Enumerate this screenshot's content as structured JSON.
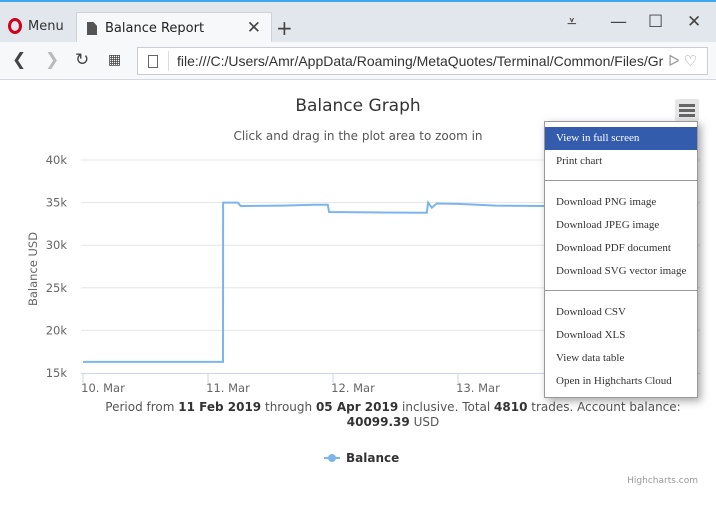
{
  "browser": {
    "menu_label": "Menu",
    "tab_title": "Balance Report",
    "url": "file:///C:/Users/Amr/AppData/Roaming/MetaQuotes/Terminal/Common/Files/Graph.html"
  },
  "chart": {
    "title": "Balance Graph",
    "subtitle": "Click and drag in the plot area to zoom in",
    "caption": {
      "p1": "Period from ",
      "from": "11 Feb 2019",
      "p2": " through ",
      "to": "05 Apr 2019",
      "p3": " inclusive. Total ",
      "trades": "4810",
      "p4": " trades. Account balance: ",
      "balance": "40099.39",
      "p5": " USD"
    },
    "legend": "Balance",
    "credits": "Highcharts.com"
  },
  "export_menu": {
    "items": [
      "View in full screen",
      "Print chart",
      "Download PNG image",
      "Download JPEG image",
      "Download PDF document",
      "Download SVG vector image",
      "Download CSV",
      "Download XLS",
      "View data table",
      "Open in Highcharts Cloud"
    ]
  },
  "chart_data": {
    "type": "line",
    "title": "Balance Graph",
    "subtitle": "Click and drag in the plot area to zoom in",
    "ylabel": "Balance USD",
    "xlabel": "",
    "ylim": [
      15000,
      40000
    ],
    "yticks": [
      "15k",
      "20k",
      "25k",
      "30k",
      "35k",
      "40k"
    ],
    "xticks": [
      "10. Mar",
      "11. Mar",
      "12. Mar",
      "13. Mar"
    ],
    "grid": true,
    "legend": "bottom-center",
    "color": "#7cb5ec",
    "series": [
      {
        "name": "Balance",
        "points": [
          [
            "2019-03-10T00:00",
            16300
          ],
          [
            "2019-03-11T02:53",
            16300
          ],
          [
            "2019-03-11T02:54",
            35000
          ],
          [
            "2019-03-11T05:45",
            35000
          ],
          [
            "2019-03-11T06:15",
            34600
          ],
          [
            "2019-03-11T14:24",
            34650
          ],
          [
            "2019-03-11T20:24",
            34750
          ],
          [
            "2019-03-11T23:00",
            34750
          ],
          [
            "2019-03-11T23:15",
            33900
          ],
          [
            "2019-03-12T07:12",
            33850
          ],
          [
            "2019-03-12T18:00",
            33800
          ],
          [
            "2019-03-12T18:15",
            35000
          ],
          [
            "2019-03-12T18:58",
            34400
          ],
          [
            "2019-03-12T19:55",
            34900
          ],
          [
            "2019-03-13T00:00",
            34850
          ],
          [
            "2019-03-13T07:12",
            34650
          ],
          [
            "2019-03-13T16:48",
            34600
          ]
        ]
      }
    ]
  }
}
